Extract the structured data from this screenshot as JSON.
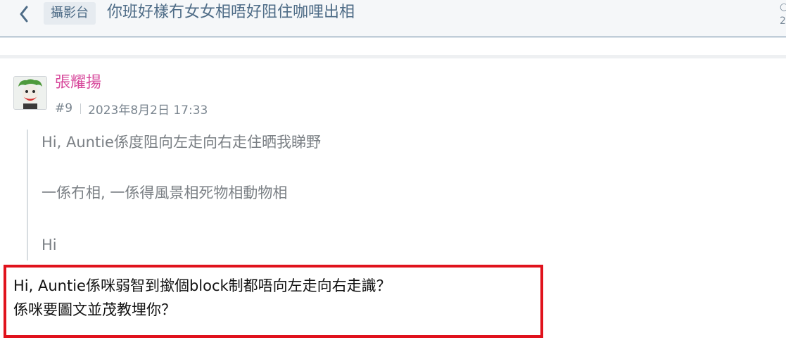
{
  "header": {
    "back_icon": "chevron-left-icon",
    "category": "攝影台",
    "title": "你班好樣冇女女相唔好阻住咖哩出相"
  },
  "post": {
    "author": "張耀揚",
    "avatar": "avatar-image",
    "number": "#9",
    "date": "2023年8月2日 17:33",
    "quote_lines": [
      "Hi, Auntie係度阻向左走向右走住晒我睇野",
      "一係冇相, 一係得風景相死物相動物相",
      "Hi"
    ],
    "reply_lines": [
      "Hi, Auntie係咪弱智到撳個block制都唔向左走向右走識？",
      "係咪要圖文並茂教埋你？"
    ]
  },
  "colors": {
    "header_bg": "#f5f7f9",
    "header_text": "#4d6b86",
    "author_name": "#d7489b",
    "highlight_border": "#e0121c"
  }
}
